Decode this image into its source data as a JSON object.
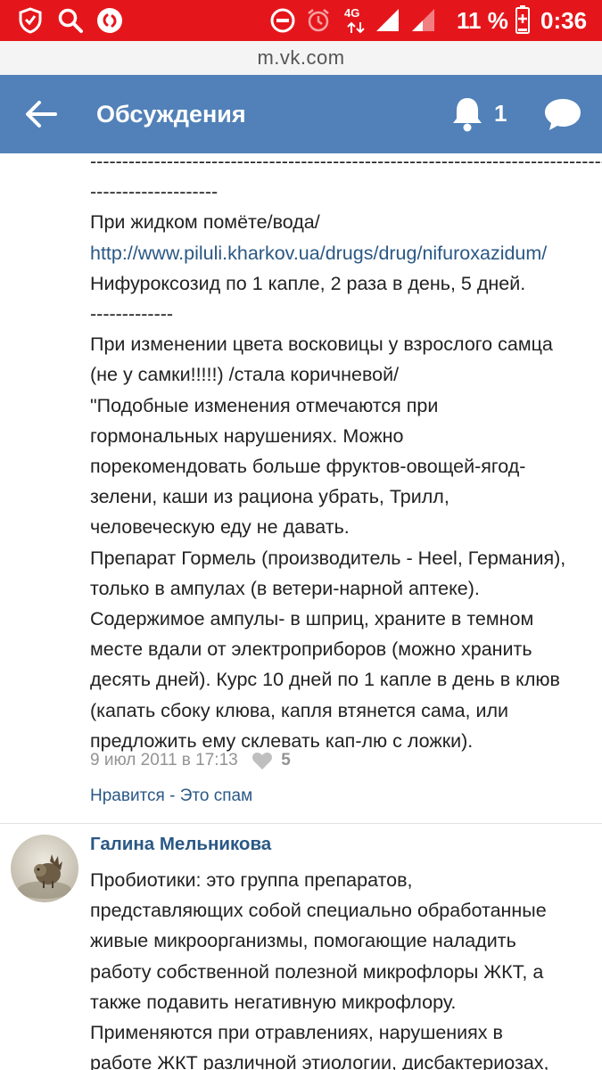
{
  "status_bar": {
    "network_type": "4G",
    "battery_percent": "11 %",
    "time": "0:36"
  },
  "browser": {
    "url": "m.vk.com"
  },
  "header": {
    "title": "Обсуждения",
    "notification_count": "1",
    "back_icon": "arrow-left-icon",
    "bell_icon": "bell-icon",
    "chat_icon": "chat-bubble-icon"
  },
  "post": {
    "lines": [
      "--------------------------------------------------------------------------------------------",
      "--------------------",
      "При жидком помёте/вода/",
      "http://www.piluli.kharkov.ua/drugs/drug/nifuroxazidum/",
      "Нифуроксозид по 1 капле, 2 раза в день, 5 дней.",
      "-------------",
      "При изменении цвета восковицы у взрослого самца",
      "(не у самки!!!!!) /стала коричневой/",
      "\"Подобные изменения отмечаются при",
      "гормональных нарушениях. Можно",
      "порекомендовать больше фруктов-овощей-ягод-",
      "зелени, каши из рациона убрать, Трилл,",
      "человеческую еду не давать.",
      "Препарат Гормель (производитель - Heel, Германия),",
      "только в ампулах (в ветери-нарной аптеке).",
      "Содержимое ампулы- в шприц, храните в темном",
      "месте вдали от электроприборов (можно хранить",
      "десять дней). Курс 10 дней по 1 капле в день в клюв",
      "(капать сбоку клюва, капля втянется сама, или",
      "предложить ему склевать кап-лю с ложки)."
    ],
    "link_line_index": 3,
    "date": "9 июл 2011 в 17:13",
    "likes": "5",
    "like_action": "Нравится",
    "separator": " - ",
    "spam_action": "Это спам"
  },
  "comment": {
    "author": "Галина Мельникова",
    "lines": [
      "Пробиотики: это группа препаратов,",
      "представляющих собой специально обработанные",
      "живые микроорганизмы, помогающие наладить",
      "работу собственной полезной микрофлоры ЖКТ, а",
      "также подавить негативную микрофлору.",
      "Применяются при отравлениях, нарушениях в",
      "работе ЖКТ различной этиологии, дисбактериозах,"
    ]
  },
  "colors": {
    "status_bar": "#e5161b",
    "header": "#5181b8",
    "link": "#2a5885",
    "meta": "#939393"
  }
}
